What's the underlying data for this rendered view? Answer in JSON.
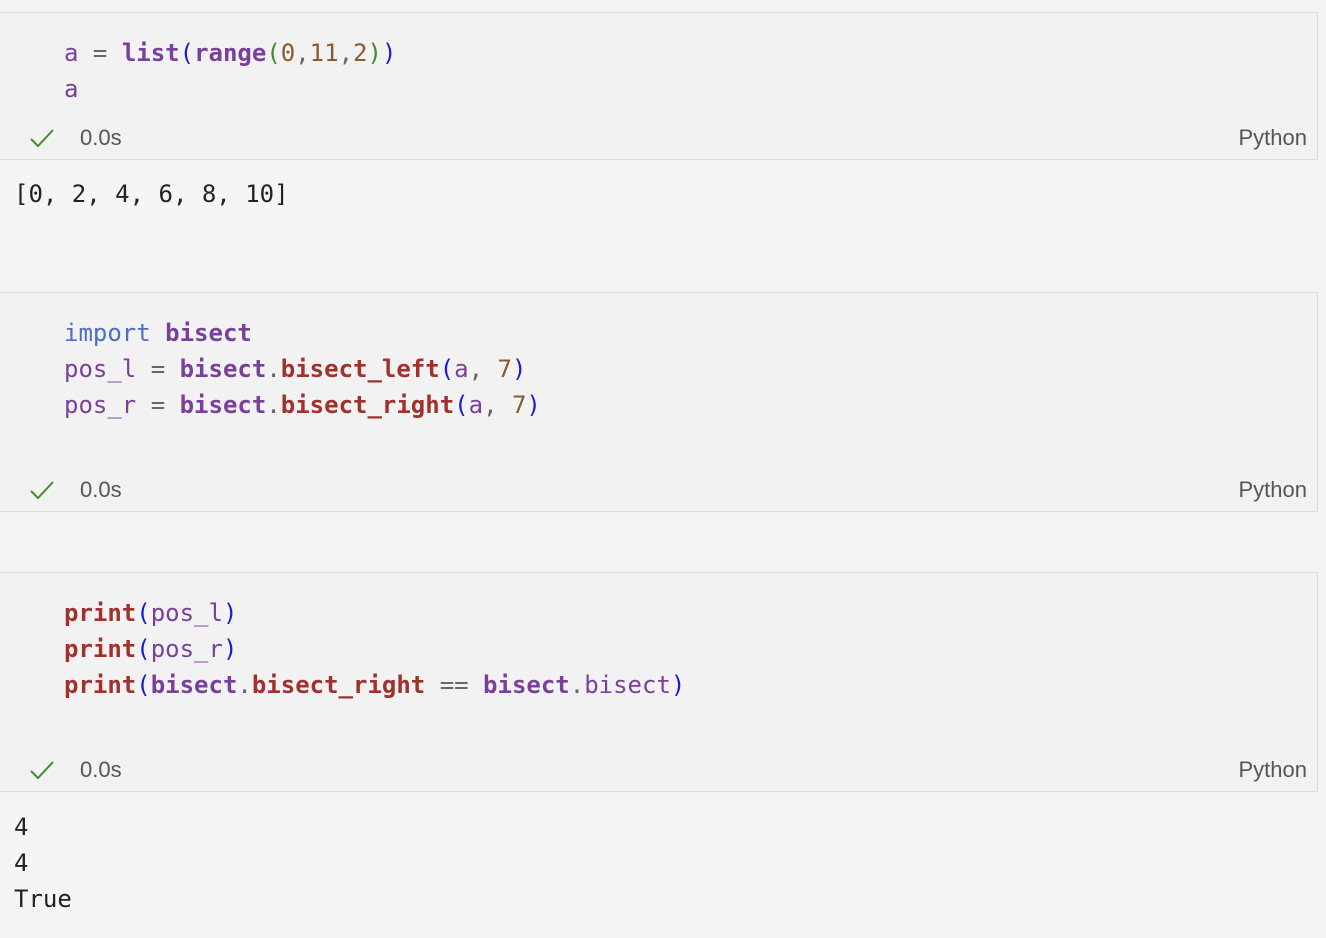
{
  "cells": [
    {
      "lines": [
        [
          [
            "var",
            "a"
          ],
          [
            "op",
            " = "
          ],
          [
            "fn",
            "list"
          ],
          [
            "pn",
            "("
          ],
          [
            "fn",
            "range"
          ],
          [
            "pg",
            "("
          ],
          [
            "num",
            "0"
          ],
          [
            "pt",
            ","
          ],
          [
            "num",
            "11"
          ],
          [
            "pt",
            ","
          ],
          [
            "num",
            "2"
          ],
          [
            "pg",
            ")"
          ],
          [
            "pn",
            ")"
          ]
        ],
        [
          [
            "var",
            "a"
          ]
        ]
      ],
      "status_time": "0.0s",
      "language": "Python",
      "output": "[0, 2, 4, 6, 8, 10]"
    },
    {
      "lines": [
        [
          [
            "kw",
            "import"
          ],
          [
            "op",
            " "
          ],
          [
            "mod",
            "bisect"
          ]
        ],
        [
          [
            "var",
            "pos_l"
          ],
          [
            "op",
            " = "
          ],
          [
            "mod",
            "bisect"
          ],
          [
            "pt",
            "."
          ],
          [
            "call",
            "bisect_left"
          ],
          [
            "pn",
            "("
          ],
          [
            "var",
            "a"
          ],
          [
            "pt",
            ", "
          ],
          [
            "num",
            "7"
          ],
          [
            "pn",
            ")"
          ]
        ],
        [
          [
            "var",
            "pos_r"
          ],
          [
            "op",
            " = "
          ],
          [
            "mod",
            "bisect"
          ],
          [
            "pt",
            "."
          ],
          [
            "call",
            "bisect_right"
          ],
          [
            "pn",
            "("
          ],
          [
            "var",
            "a"
          ],
          [
            "pt",
            ", "
          ],
          [
            "num",
            "7"
          ],
          [
            "pn",
            ")"
          ]
        ]
      ],
      "status_time": "0.0s",
      "language": "Python",
      "output": ""
    },
    {
      "lines": [
        [
          [
            "call",
            "print"
          ],
          [
            "pn",
            "("
          ],
          [
            "var",
            "pos_l"
          ],
          [
            "pn",
            ")"
          ]
        ],
        [
          [
            "call",
            "print"
          ],
          [
            "pn",
            "("
          ],
          [
            "var",
            "pos_r"
          ],
          [
            "pn",
            ")"
          ]
        ],
        [
          [
            "call",
            "print"
          ],
          [
            "pn",
            "("
          ],
          [
            "mod",
            "bisect"
          ],
          [
            "pt",
            "."
          ],
          [
            "call",
            "bisect_right"
          ],
          [
            "op",
            " == "
          ],
          [
            "mod",
            "bisect"
          ],
          [
            "pt",
            "."
          ],
          [
            "attr",
            "bisect"
          ],
          [
            "pn",
            ")"
          ]
        ]
      ],
      "status_time": "0.0s",
      "language": "Python",
      "output": "4\n4\nTrue"
    }
  ],
  "colors": {
    "keyword": "#4a6fc4",
    "variable": "#7a3f9a",
    "function_call": "#a0322d",
    "number": "#8a5a2e",
    "paren_outer": "#1a1ad4",
    "paren_inner": "#3f8a2e",
    "check": "#3f8a2e"
  },
  "icons": {
    "status": "check-icon"
  }
}
